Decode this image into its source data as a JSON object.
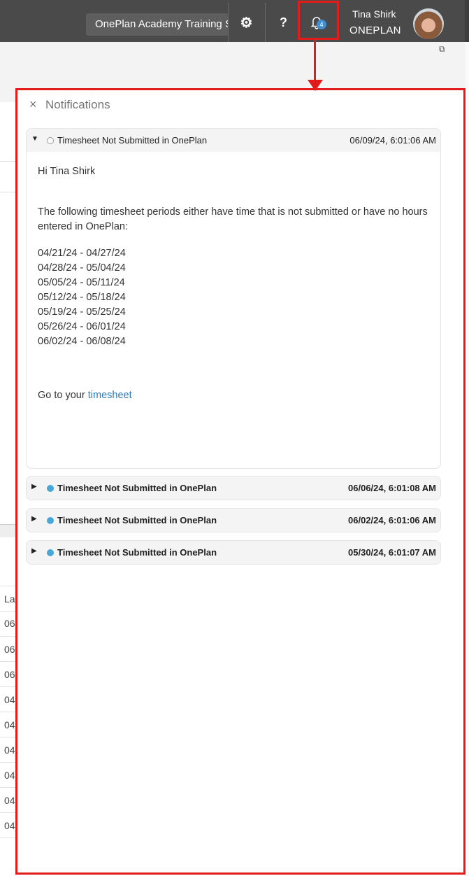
{
  "header": {
    "workspace": "OnePlan Academy Training Site",
    "settings_icon": "gear-icon",
    "help_label": "?",
    "bell_icon": "bell-icon",
    "notification_count": "4",
    "user_name": "Tina Shirk",
    "user_org": "ONEPLAN"
  },
  "background": {
    "column_header": "La",
    "row_cells": [
      "06",
      "06",
      "06",
      "04",
      "04",
      "04",
      "04",
      "04",
      "04",
      "04"
    ]
  },
  "notifications": {
    "close_label": "×",
    "title": "Notifications",
    "expanded": {
      "title": "Timesheet Not Submitted in OnePlan",
      "date": "06/09/24, 6:01:06 AM",
      "greeting": "Hi Tina Shirk",
      "paragraph": "The following timesheet periods either have time that is not submitted or have no hours entered in OnePlan:",
      "periods": [
        "04/21/24 - 04/27/24",
        "04/28/24 - 05/04/24",
        "05/05/24 - 05/11/24",
        "05/12/24 - 05/18/24",
        "05/19/24 - 05/25/24",
        "05/26/24 - 06/01/24",
        "06/02/24 - 06/08/24"
      ],
      "goto_text": "Go to your ",
      "goto_link": "timesheet"
    },
    "collapsed": [
      {
        "title": "Timesheet Not Submitted in OnePlan",
        "date": "06/06/24, 6:01:08 AM"
      },
      {
        "title": "Timesheet Not Submitted in OnePlan",
        "date": "06/02/24, 6:01:06 AM"
      },
      {
        "title": "Timesheet Not Submitted in OnePlan",
        "date": "05/30/24, 6:01:07 AM"
      }
    ]
  },
  "colors": {
    "topbar": "#4a4a4a",
    "annotation_red": "#e21b1b",
    "unread_dot": "#4aa6d6",
    "link": "#2f7ab8"
  }
}
